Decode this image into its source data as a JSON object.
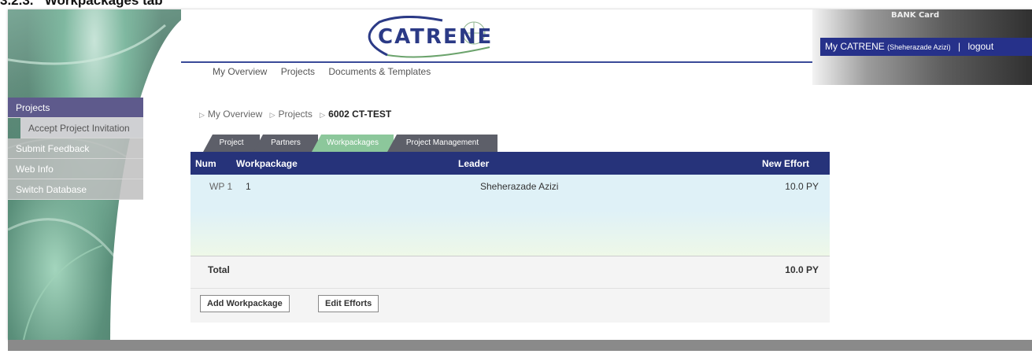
{
  "doc": {
    "heading": "3.2.3.   Workpackages tab"
  },
  "header": {
    "logo_text": "CATRENE",
    "card_label": "BANK Card",
    "user_prefix": "My CATRENE",
    "user_name": "(Sheherazade Azizi)",
    "separator": "|",
    "logout": "logout"
  },
  "topnav": [
    "My Overview",
    "Projects",
    "Documents & Templates"
  ],
  "sidebar": {
    "items": [
      {
        "label": "Projects"
      },
      {
        "label": "Accept Project Invitation"
      },
      {
        "label": "Submit Feedback"
      },
      {
        "label": "Web Info"
      },
      {
        "label": "Switch Database"
      }
    ]
  },
  "breadcrumb": {
    "items": [
      "My Overview",
      "Projects"
    ],
    "current": "6002 CT-TEST"
  },
  "tabs": [
    "Project",
    "Partners",
    "Workpackages",
    "Project Management"
  ],
  "table": {
    "headers": {
      "num": "Num",
      "workpackage": "Workpackage",
      "leader": "Leader",
      "effort": "New Effort"
    },
    "rows": [
      {
        "num": "WP 1",
        "workpackage": "1",
        "leader": "Sheherazade Azizi",
        "effort": "10.0 PY"
      }
    ],
    "total_label": "Total",
    "total_value": "10.0 PY"
  },
  "actions": {
    "add": "Add Workpackage",
    "edit": "Edit Efforts"
  },
  "colors": {
    "accent": "#26337a",
    "active_tab": "#8cc79b",
    "sidebar_active": "#5e5a8c"
  }
}
